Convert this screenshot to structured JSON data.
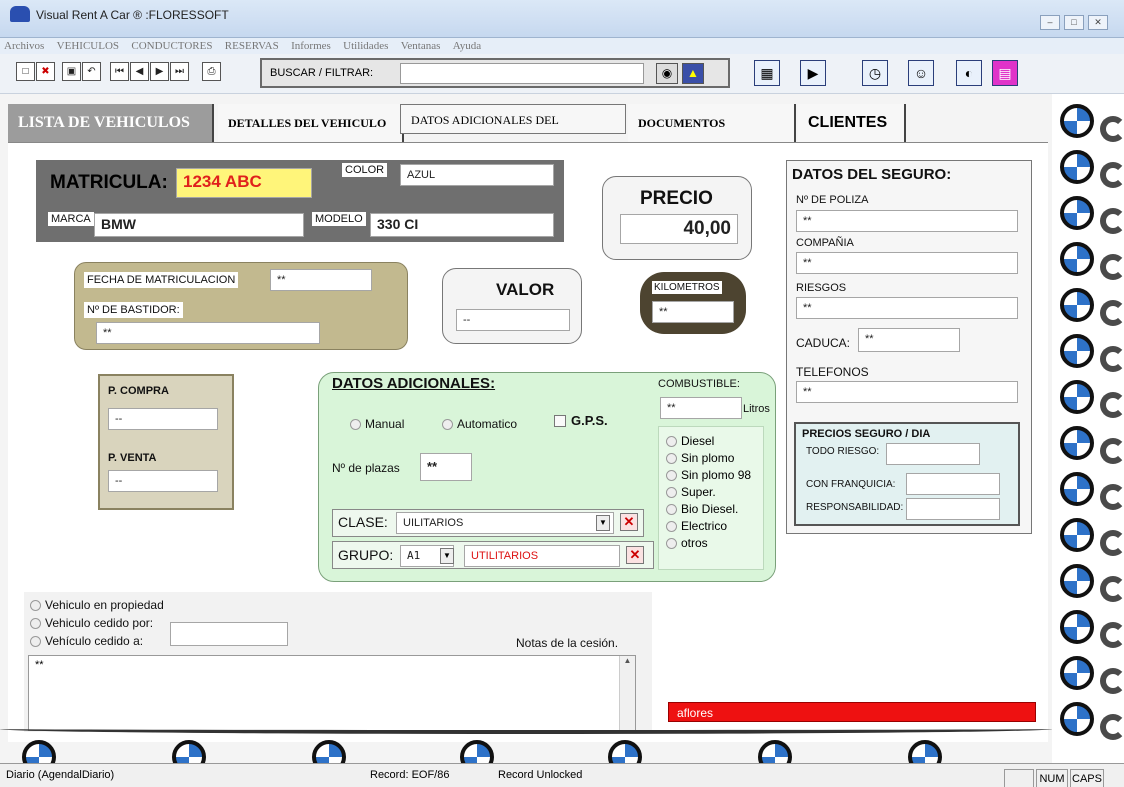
{
  "window": {
    "title": "Visual Rent A Car ® :FLORESSOFT"
  },
  "menu": [
    "Archivos",
    "VEHICULOS",
    "CONDUCTORES",
    "RESERVAS",
    "Informes",
    "Utilidades",
    "Ventanas",
    "Ayuda"
  ],
  "toolbar": {
    "search_label": "BUSCAR / FILTRAR:",
    "search_value": ""
  },
  "tabs": [
    "LISTA DE VEHICULOS",
    "DETALLES DEL VEHICULO",
    "DATOS ADICIONALES DEL VEHICULO",
    "DOCUMENTOS VEHICULO",
    "CLIENTES"
  ],
  "vehicle": {
    "matricula_label": "MATRICULA:",
    "matricula": "1234 ABC",
    "color_label": "COLOR",
    "color": "AZUL",
    "marca_label": "MARCA",
    "marca": "BMW",
    "modelo_label": "MODELO",
    "modelo": "330 CI"
  },
  "precio": {
    "label": "PRECIO",
    "value": "40,00"
  },
  "fecha": {
    "label": "FECHA DE MATRICULACION",
    "value": "**",
    "bastidor_label": "Nº DE BASTIDOR:",
    "bastidor": "**"
  },
  "valor": {
    "label": "VALOR",
    "value": "--"
  },
  "km": {
    "label": "KILOMETROS",
    "value": "**"
  },
  "compra": {
    "compra_label": "P. COMPRA",
    "compra": "--",
    "venta_label": "P. VENTA",
    "venta": "--"
  },
  "adicionales": {
    "title": "DATOS ADICIONALES:",
    "manual": "Manual",
    "automatico": "Automatico",
    "gps": "G.P.S.",
    "plazas_label": "Nº de plazas",
    "plazas": "**",
    "clase_label": "CLASE:",
    "clase": "UILITARIOS",
    "grupo_label": "GRUPO:",
    "grupo_code": "A1",
    "grupo": "UTILITARIOS",
    "combustible_label": "COMBUSTIBLE:",
    "combustible": "**",
    "litros": "Litros",
    "fuels": [
      "Diesel",
      "Sin plomo",
      "Sin plomo 98",
      "Super.",
      "Bio Diesel.",
      "Electrico",
      "otros"
    ]
  },
  "seguro": {
    "title": "DATOS DEL SEGURO:",
    "poliza_label": "Nº DE POLIZA",
    "poliza": "**",
    "compania_label": "COMPAÑIA",
    "compania": "**",
    "riesgos_label": "RIESGOS",
    "riesgos": "**",
    "caduca_label": "CADUCA:",
    "caduca": "**",
    "telefonos_label": "TELEFONOS",
    "telefonos": "**",
    "precios_title": "PRECIOS SEGURO / DIA",
    "todo_label": "TODO RIESGO:",
    "franquicia_label": "CON FRANQUICIA:",
    "resp_label": "RESPONSABILIDAD:"
  },
  "propiedad": {
    "opt1": "Vehiculo en propiedad",
    "opt2": "Vehiculo cedido por:",
    "opt3": "Vehículo cedido a:",
    "notas_label": "Notas de la cesión.",
    "notas": "**"
  },
  "user": "aflores",
  "status": {
    "left": "Diario (AgendalDiario)",
    "record": "Record: EOF/86",
    "lock": "Record Unlocked",
    "num": "NUM",
    "caps": "CAPS"
  },
  "colors": {
    "matricula_bg": "#fff57a",
    "matricula_text": "#e0201c",
    "user_bar": "#ee1111",
    "green_panel": "#d9f5d9",
    "olive_panel": "#c2b98f",
    "grey_panel": "#6f6f6f"
  }
}
